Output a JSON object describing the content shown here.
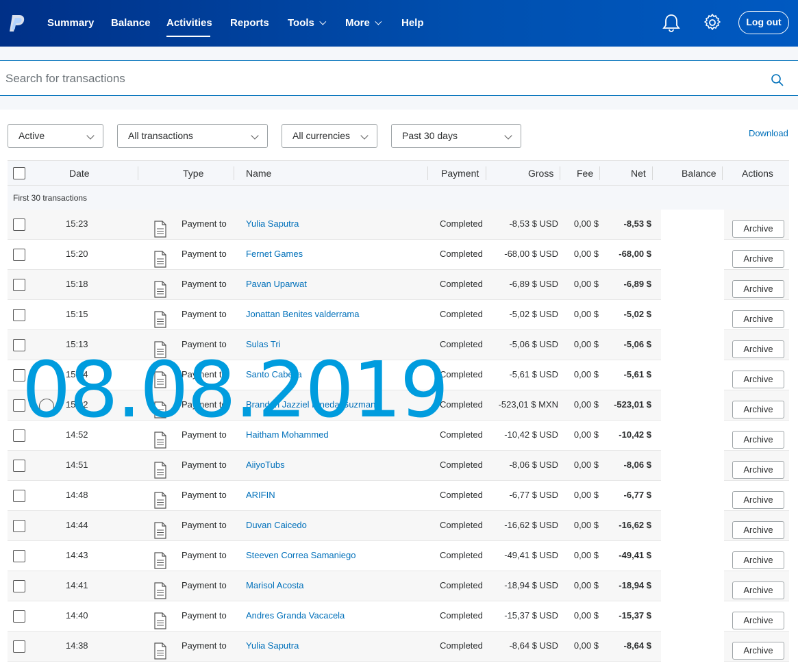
{
  "nav": {
    "items": [
      {
        "label": "Summary"
      },
      {
        "label": "Balance"
      },
      {
        "label": "Activities"
      },
      {
        "label": "Reports"
      },
      {
        "label": "Tools"
      },
      {
        "label": "More"
      },
      {
        "label": "Help"
      }
    ],
    "active": "Activities",
    "logout_label": "Log out"
  },
  "search": {
    "placeholder": "Search for transactions"
  },
  "filters": {
    "status": "Active",
    "type": "All transactions",
    "currency": "All currencies",
    "period": "Past 30 days",
    "download_label": "Download"
  },
  "table": {
    "headers": {
      "date": "Date",
      "type": "Type",
      "name": "Name",
      "payment": "Payment",
      "gross": "Gross",
      "fee": "Fee",
      "net": "Net",
      "balance": "Balance",
      "actions": "Actions"
    },
    "group_label": "First 30 transactions",
    "archive_label": "Archive",
    "rows": [
      {
        "time": "15:23",
        "type": "Payment to",
        "name": "Yulia Saputra",
        "status": "Completed",
        "gross": "-8,53 $ USD",
        "fee": "0,00 $",
        "net": "-8,53 $"
      },
      {
        "time": "15:20",
        "type": "Payment to",
        "name": "Fernet Games",
        "status": "Completed",
        "gross": "-68,00 $ USD",
        "fee": "0,00 $",
        "net": "-68,00 $"
      },
      {
        "time": "15:18",
        "type": "Payment to",
        "name": "Pavan Uparwat",
        "status": "Completed",
        "gross": "-6,89 $ USD",
        "fee": "0,00 $",
        "net": "-6,89 $"
      },
      {
        "time": "15:15",
        "type": "Payment to",
        "name": "Jonattan Benites valderrama",
        "status": "Completed",
        "gross": "-5,02 $ USD",
        "fee": "0,00 $",
        "net": "-5,02 $"
      },
      {
        "time": "15:13",
        "type": "Payment to",
        "name": "Sulas Tri",
        "status": "Completed",
        "gross": "-5,06 $ USD",
        "fee": "0,00 $",
        "net": "-5,06 $"
      },
      {
        "time": "15:04",
        "type": "Payment to",
        "name": "Santo Cabella",
        "status": "Completed",
        "gross": "-5,61 $ USD",
        "fee": "0,00 $",
        "net": "-5,61 $"
      },
      {
        "time": "15:02",
        "type": "Payment to",
        "name": "Brandon Jazziel Pineda Guzman",
        "status": "Completed",
        "gross": "-523,01 $ MXN",
        "fee": "0,00 $",
        "net": "-523,01 $"
      },
      {
        "time": "14:52",
        "type": "Payment to",
        "name": "Haitham Mohammed",
        "status": "Completed",
        "gross": "-10,42 $ USD",
        "fee": "0,00 $",
        "net": "-10,42 $"
      },
      {
        "time": "14:51",
        "type": "Payment to",
        "name": "AiiyoTubs",
        "status": "Completed",
        "gross": "-8,06 $ USD",
        "fee": "0,00 $",
        "net": "-8,06 $"
      },
      {
        "time": "14:48",
        "type": "Payment to",
        "name": "ARIFIN",
        "status": "Completed",
        "gross": "-6,77 $ USD",
        "fee": "0,00 $",
        "net": "-6,77 $"
      },
      {
        "time": "14:44",
        "type": "Payment to",
        "name": "Duvan Caicedo",
        "status": "Completed",
        "gross": "-16,62 $ USD",
        "fee": "0,00 $",
        "net": "-16,62 $"
      },
      {
        "time": "14:43",
        "type": "Payment to",
        "name": "Steeven Correa Samaniego",
        "status": "Completed",
        "gross": "-49,41 $ USD",
        "fee": "0,00 $",
        "net": "-49,41 $"
      },
      {
        "time": "14:41",
        "type": "Payment to",
        "name": "Marisol Acosta",
        "status": "Completed",
        "gross": "-18,94 $ USD",
        "fee": "0,00 $",
        "net": "-18,94 $"
      },
      {
        "time": "14:40",
        "type": "Payment to",
        "name": "Andres Granda Vacacela",
        "status": "Completed",
        "gross": "-15,37 $ USD",
        "fee": "0,00 $",
        "net": "-15,37 $"
      },
      {
        "time": "14:38",
        "type": "Payment to",
        "name": "Yulia Saputra",
        "status": "Completed",
        "gross": "-8,64 $ USD",
        "fee": "0,00 $",
        "net": "-8,64 $"
      }
    ]
  },
  "overlay": {
    "date_text": "08.08.2019"
  },
  "colors": {
    "brand": "#003087",
    "link": "#0070ba",
    "overlay": "#009cde"
  }
}
